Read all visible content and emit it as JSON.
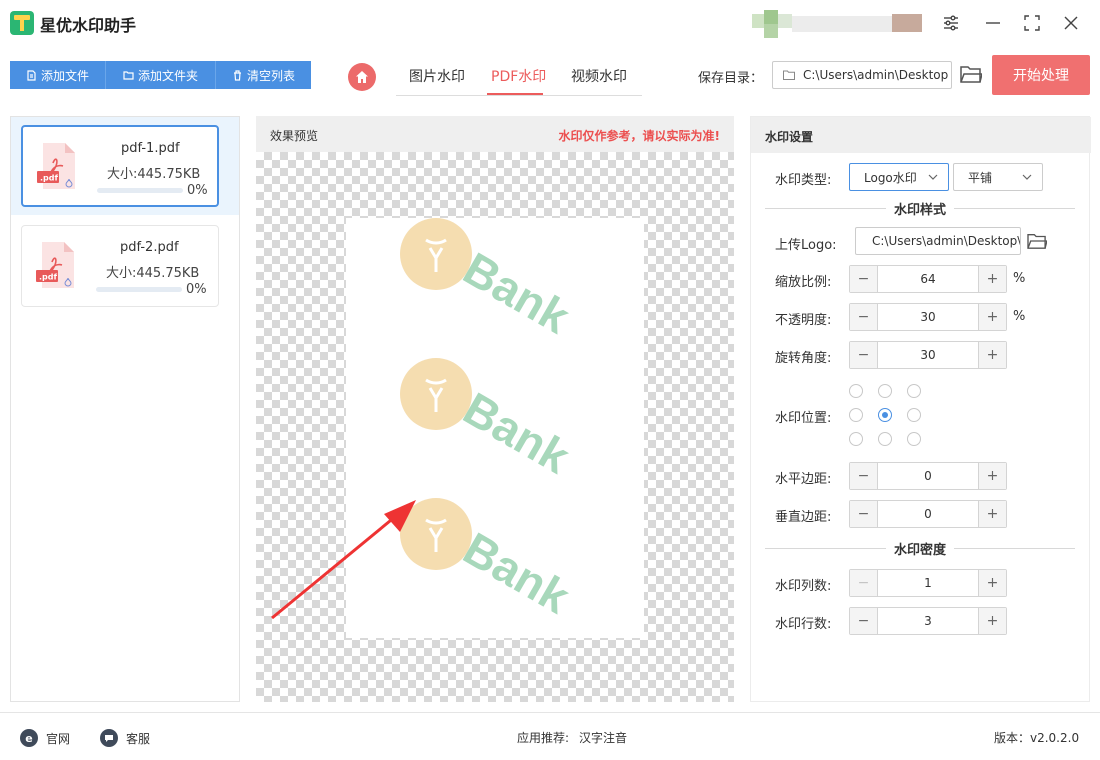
{
  "app": {
    "title": "星优水印助手"
  },
  "toolbar": {
    "add_file": "添加文件",
    "add_folder": "添加文件夹",
    "clear_list": "清空列表"
  },
  "tabs": [
    {
      "label": "图片水印"
    },
    {
      "label": "PDF水印"
    },
    {
      "label": "视频水印"
    }
  ],
  "save": {
    "label": "保存目录：",
    "path": "C:\\Users\\admin\\Desktop",
    "start_button": "开始处理"
  },
  "files": [
    {
      "name": "pdf-1.pdf",
      "size": "大小:445.75KB",
      "percent": "0%",
      "progress": 0,
      "badge": ".pdf"
    },
    {
      "name": "pdf-2.pdf",
      "size": "大小:445.75KB",
      "percent": "0%",
      "progress": 0,
      "badge": ".pdf"
    }
  ],
  "preview": {
    "title": "效果预览",
    "note": "水印仅作参考，请以实际为准!",
    "watermark_text": "Bank",
    "watermark_count": 3
  },
  "settings": {
    "title": "水印设置",
    "type_label": "水印类型:",
    "type_value": "Logo水印",
    "layout_value": "平铺",
    "style_section": "水印样式",
    "logo_label": "上传Logo:",
    "logo_path": "C:\\Users\\admin\\Desktop\\",
    "scale_label": "缩放比例:",
    "scale_value": "64",
    "scale_unit": "%",
    "opacity_label": "不透明度:",
    "opacity_value": "30",
    "opacity_unit": "%",
    "rotation_label": "旋转角度:",
    "rotation_value": "30",
    "position_label": "水印位置:",
    "position_selected": "center",
    "hmargin_label": "水平边距:",
    "hmargin_value": "0",
    "vmargin_label": "垂直边距:",
    "vmargin_value": "0",
    "density_section": "水印密度",
    "cols_label": "水印列数:",
    "cols_value": "1",
    "rows_label": "水印行数:",
    "rows_value": "3",
    "minus": "−",
    "plus": "+"
  },
  "statusbar": {
    "website": "官网",
    "website_icon": "e",
    "support": "客服",
    "recommend_label": "应用推荐:",
    "recommend_app": "汉字注音",
    "version": "版本：v2.0.2.0"
  },
  "colors": {
    "accent": "#4a90e2",
    "brand_red": "#ec5c5c",
    "watermark_circle": "#f5ddb0",
    "watermark_text": "#a8d8bb"
  }
}
